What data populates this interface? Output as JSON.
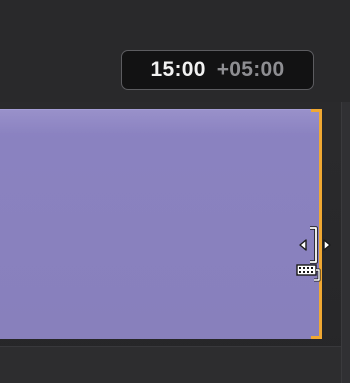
{
  "timeline": {
    "timecode": {
      "current": "15:00",
      "delta": "+05:00"
    },
    "clip": {
      "color": "#8a82c0",
      "trim_edge_color": "#f0a832",
      "selected_edge": "right"
    },
    "cursor": {
      "icon": "ripple-trim-icon"
    }
  }
}
